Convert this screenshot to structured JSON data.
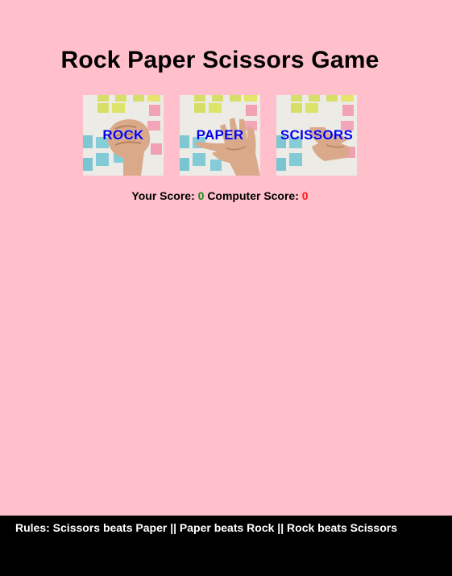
{
  "game": {
    "title": "Rock Paper Scissors Game"
  },
  "choices": [
    {
      "label": "ROCK",
      "icon": "rock-hand-icon"
    },
    {
      "label": "PAPER",
      "icon": "paper-hand-icon"
    },
    {
      "label": "SCISSORS",
      "icon": "scissors-hand-icon"
    }
  ],
  "scoreboard": {
    "your_label": "Your Score:",
    "your_score": "0",
    "computer_label": "Computer Score:",
    "computer_score": "0"
  },
  "footer": {
    "rules": "Rules: Scissors beats Paper || Paper beats Rock || Rock beats Scissors"
  },
  "colors": {
    "background": "#ffc0cb",
    "choice_label": "#0000ee",
    "your_score": "#1a8a1a",
    "computer_score": "#ff1a1a",
    "footer_bg": "#000000"
  }
}
